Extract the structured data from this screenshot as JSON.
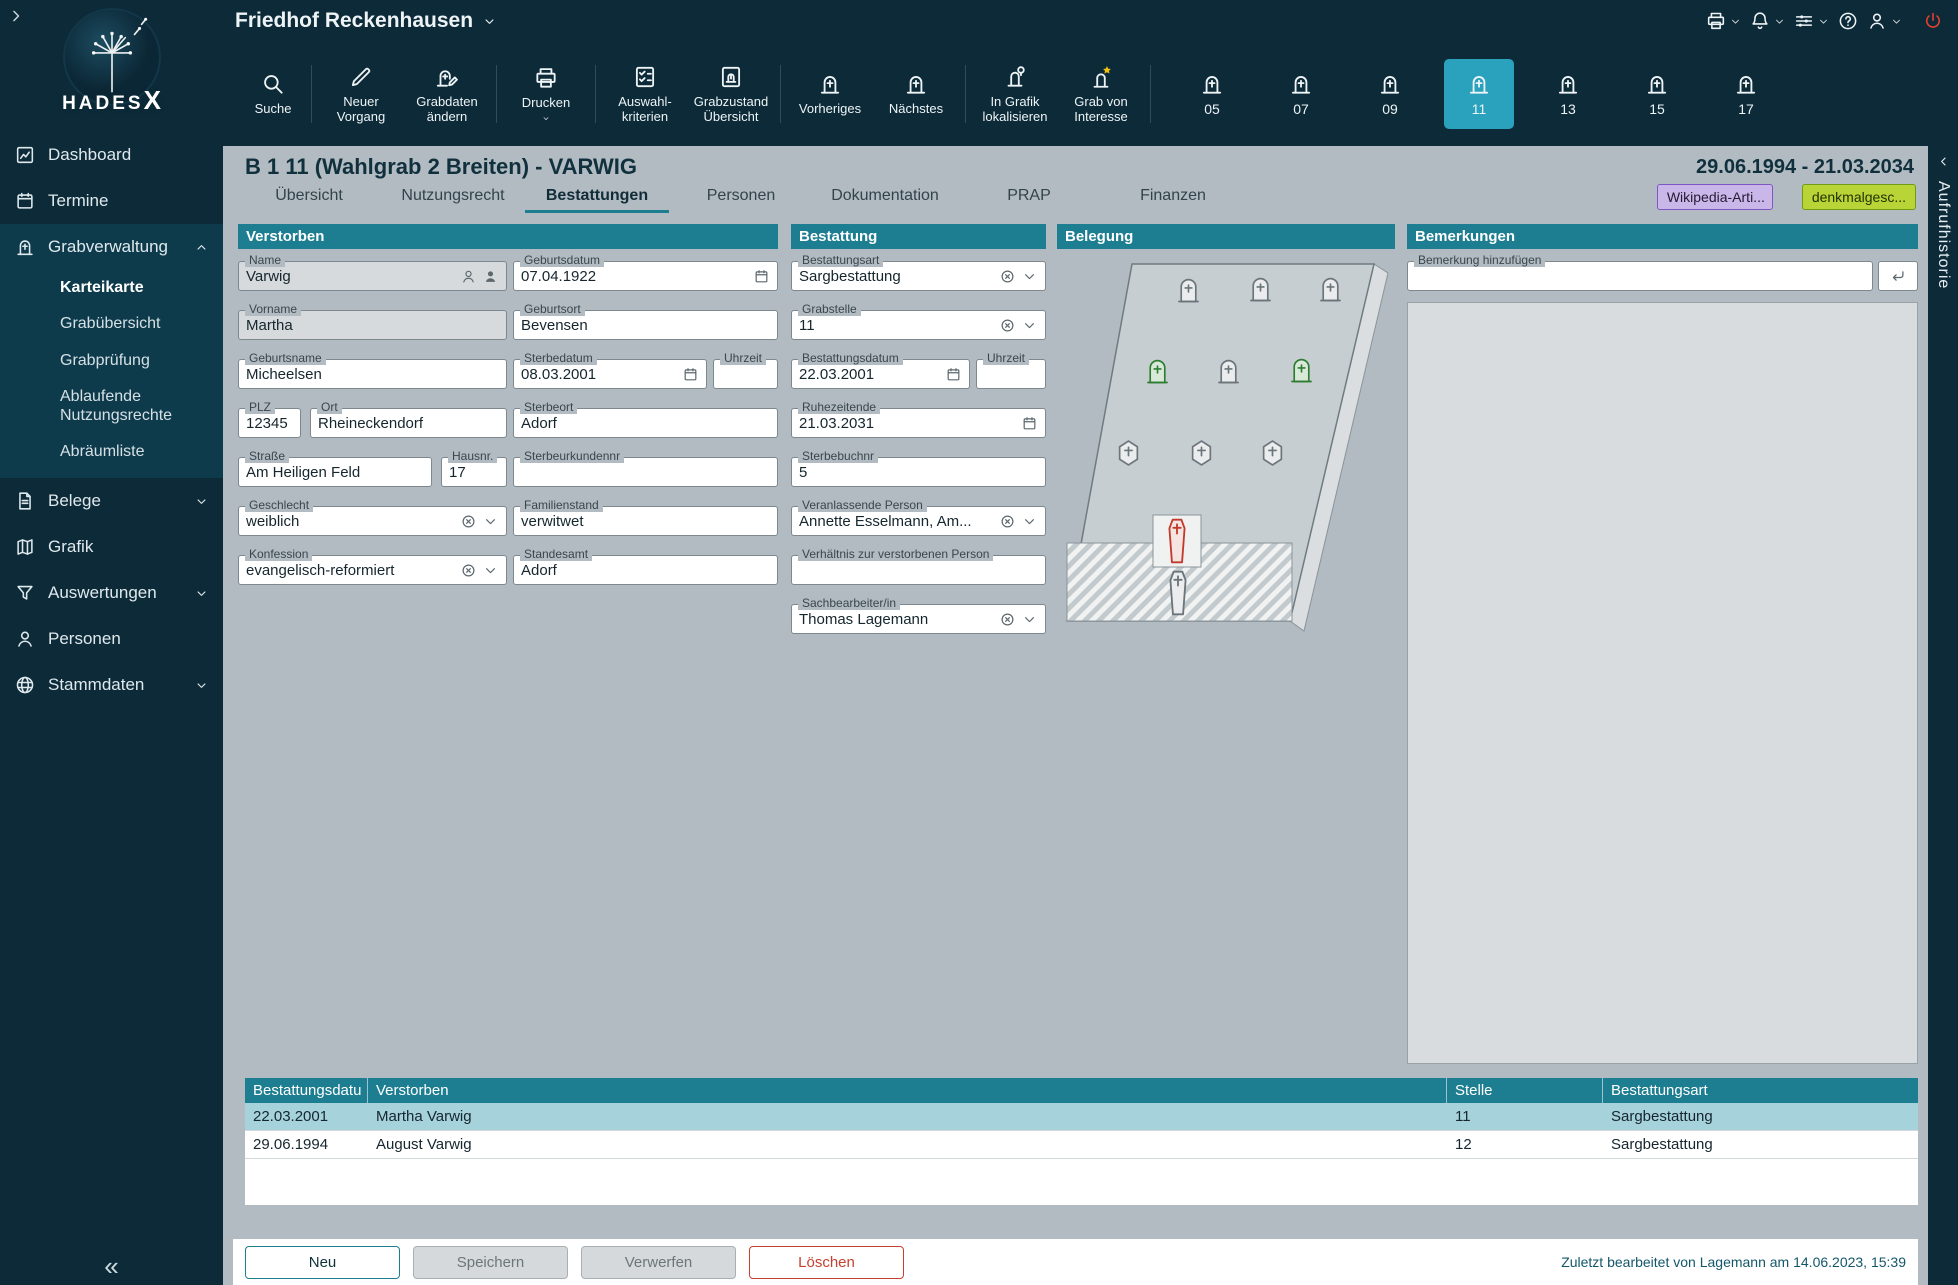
{
  "colors": {
    "accent_teal": "#1e7e91",
    "selected_grave_tab": "#2aa2be",
    "selected_row": "#a6d2dc",
    "danger_red": "#c6402f",
    "badge_wikipedia_bg": "#c9b7e9",
    "badge_denkmal_bg": "#b9d437"
  },
  "sidebar": {
    "logo_text": "HADES",
    "logo_x": "X",
    "collapse_glyph": "«",
    "items": [
      {
        "label": "Dashboard"
      },
      {
        "label": "Termine"
      },
      {
        "label": "Grabverwaltung"
      },
      {
        "label": "Karteikarte"
      },
      {
        "label": "Grabübersicht"
      },
      {
        "label": "Grabprüfung"
      },
      {
        "label": "Ablaufende Nutzungsrechte"
      },
      {
        "label": "Abräumliste"
      },
      {
        "label": "Belege"
      },
      {
        "label": "Grafik"
      },
      {
        "label": "Auswertungen"
      },
      {
        "label": "Personen"
      },
      {
        "label": "Stammdaten"
      }
    ]
  },
  "topbar": {
    "title": "Friedhof Reckenhausen",
    "toolbar": [
      {
        "label": "Suche",
        "icon": "search-icon"
      },
      {
        "label": "Neuer Vorgang",
        "icon": "new-record-icon"
      },
      {
        "label": "Grabdaten ändern",
        "icon": "edit-grave-icon"
      },
      {
        "label": "Drucken",
        "icon": "printer-icon"
      },
      {
        "label": "Auswahl-kriterien",
        "icon": "criteria-icon"
      },
      {
        "label": "Grabzustand Übersicht",
        "icon": "grave-state-icon"
      },
      {
        "label": "Vorheriges",
        "icon": "previous-grave-icon"
      },
      {
        "label": "Nächstes",
        "icon": "next-grave-icon"
      },
      {
        "label": "In Grafik lokalisieren",
        "icon": "locate-grave-icon"
      },
      {
        "label": "Grab von Interesse",
        "icon": "grave-interest-icon"
      }
    ],
    "grave_tabs": {
      "items": [
        "05",
        "07",
        "09",
        "11",
        "13",
        "15",
        "17"
      ],
      "selected": "11"
    }
  },
  "page": {
    "title": "B 1 11 (Wahlgrab 2 Breiten) - VARWIG",
    "date_range": "29.06.1994 - 21.03.2034"
  },
  "tabs": [
    "Übersicht",
    "Nutzungsrecht",
    "Bestattungen",
    "Personen",
    "Dokumentation",
    "PRAP",
    "Finanzen"
  ],
  "active_tab": "Bestattungen",
  "badges": [
    "Wikipedia-Arti...",
    "denkmalgesc..."
  ],
  "sections": {
    "verstorben": "Verstorben",
    "bestattung": "Bestattung",
    "belegung": "Belegung",
    "bemerkungen": "Bemerkungen"
  },
  "form": {
    "verstorben": {
      "name": {
        "label": "Name",
        "value": "Varwig"
      },
      "geburtsdatum": {
        "label": "Geburtsdatum",
        "value": "07.04.1922"
      },
      "vorname": {
        "label": "Vorname",
        "value": "Martha"
      },
      "geburtsort": {
        "label": "Geburtsort",
        "value": "Bevensen"
      },
      "geburtsname": {
        "label": "Geburtsname",
        "value": "Micheelsen"
      },
      "sterbedatum": {
        "label": "Sterbedatum",
        "value": "08.03.2001"
      },
      "uhrzeit_tod": {
        "label": "Uhrzeit",
        "value": ""
      },
      "plz": {
        "label": "PLZ",
        "value": "12345"
      },
      "ort": {
        "label": "Ort",
        "value": "Rheineckendorf"
      },
      "sterbeort": {
        "label": "Sterbeort",
        "value": "Adorf"
      },
      "strasse": {
        "label": "Straße",
        "value": "Am Heiligen Feld"
      },
      "hausnr": {
        "label": "Hausnr.",
        "value": "17"
      },
      "sterbeurkundennr": {
        "label": "Sterbeurkundennr",
        "value": ""
      },
      "geschlecht": {
        "label": "Geschlecht",
        "value": "weiblich"
      },
      "familienstand": {
        "label": "Familienstand",
        "value": "verwitwet"
      },
      "konfession": {
        "label": "Konfession",
        "value": "evangelisch-reformiert"
      },
      "standesamt": {
        "label": "Standesamt",
        "value": "Adorf"
      }
    },
    "bestattung": {
      "bestattungsart": {
        "label": "Bestattungsart",
        "value": "Sargbestattung"
      },
      "grabstelle": {
        "label": "Grabstelle",
        "value": "11"
      },
      "bestattungsdatum": {
        "label": "Bestattungsdatum",
        "value": "22.03.2001"
      },
      "uhrzeit": {
        "label": "Uhrzeit",
        "value": ""
      },
      "ruhezeitende": {
        "label": "Ruhezeitende",
        "value": "21.03.2031"
      },
      "sterbebuchnr": {
        "label": "Sterbebuchnr",
        "value": "5"
      },
      "veranlassende_person": {
        "label": "Veranlassende Person",
        "value": "Annette Esselmann, Am..."
      },
      "verhaeltnis": {
        "label": "Verhältnis zur verstorbenen Person",
        "value": ""
      },
      "sachbearbeiter": {
        "label": "Sachbearbeiter/in",
        "value": "Thomas Lagemann"
      }
    },
    "bemerkungen": {
      "add_label": "Bemerkung hinzufügen"
    }
  },
  "grave_table": {
    "headers": [
      "Bestattungsdatu",
      "Verstorben",
      "Stelle",
      "Bestattungsart"
    ],
    "rows": [
      [
        "22.03.2001",
        "Martha Varwig",
        "11",
        "Sargbestattung"
      ],
      [
        "29.06.1994",
        "August Varwig",
        "12",
        "Sargbestattung"
      ]
    ],
    "selected_row_index": 0
  },
  "footer": {
    "neu": "Neu",
    "speichern": "Speichern",
    "verwerfen": "Verwerfen",
    "loeschen": "Löschen",
    "status": "Zuletzt bearbeitet von Lagemann am 14.06.2023, 15:39"
  },
  "history": {
    "title": "Aufrufhistorie"
  }
}
